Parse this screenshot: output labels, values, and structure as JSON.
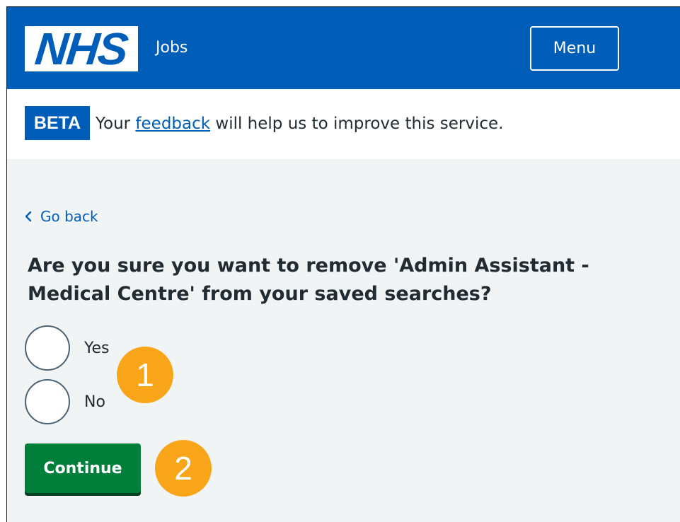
{
  "header": {
    "logo": "NHS",
    "service_name": "Jobs",
    "menu_label": "Menu"
  },
  "beta_banner": {
    "tag": "BETA",
    "text_before": "Your ",
    "link_text": "feedback",
    "text_after": " will help us to improve this service."
  },
  "back_link": {
    "label": "Go back"
  },
  "question": "Are you sure you want to remove 'Admin Assistant - Medical Centre' from your saved searches?",
  "options": [
    {
      "label": "Yes",
      "selected": false
    },
    {
      "label": "No",
      "selected": false
    }
  ],
  "continue_label": "Continue",
  "callouts": [
    "1",
    "2"
  ],
  "colors": {
    "nhs_blue": "#005eb8",
    "page_background": "#f0f4f5",
    "button_green": "#007f3b",
    "callout_orange": "#f9a51a",
    "text": "#212b32"
  }
}
